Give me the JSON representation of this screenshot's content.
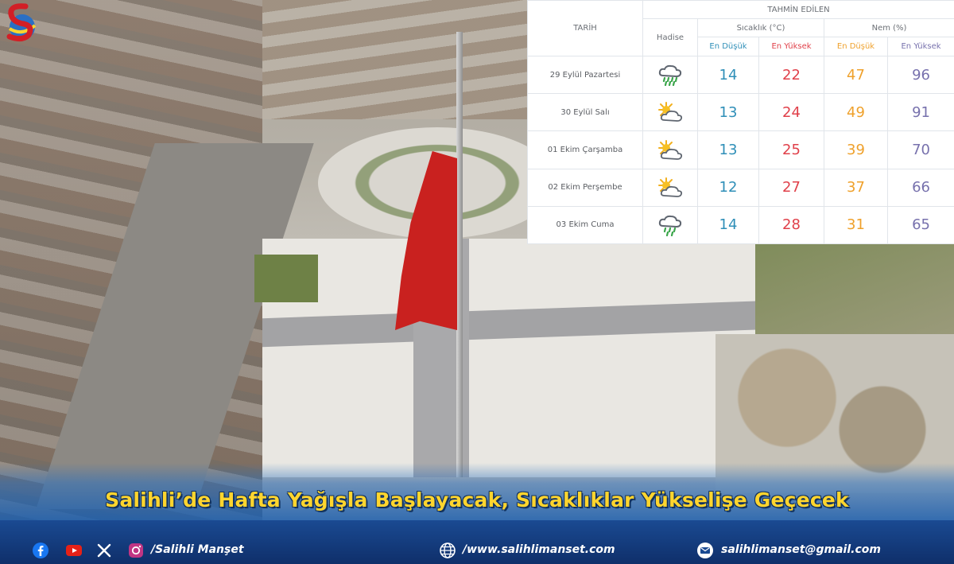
{
  "forecast": {
    "header_forecast": "TAHMİN EDİLEN",
    "col_date": "TARİH",
    "col_event": "Hadise",
    "col_temp": "Sıcaklık (°C)",
    "col_humidity": "Nem (%)",
    "sub_low": "En Düşük",
    "sub_high": "En Yüksek",
    "rows": [
      {
        "date": "29 Eylül Pazartesi",
        "icon": "rain-cloud-icon",
        "temp_low": "14",
        "temp_high": "22",
        "hum_low": "47",
        "hum_high": "96"
      },
      {
        "date": "30 Eylül Salı",
        "icon": "partly-cloudy-icon",
        "temp_low": "13",
        "temp_high": "24",
        "hum_low": "49",
        "hum_high": "91"
      },
      {
        "date": "01 Ekim Çarşamba",
        "icon": "partly-cloudy-icon",
        "temp_low": "13",
        "temp_high": "25",
        "hum_low": "39",
        "hum_high": "70"
      },
      {
        "date": "02 Ekim Perşembe",
        "icon": "partly-cloudy-icon",
        "temp_low": "12",
        "temp_high": "27",
        "hum_low": "37",
        "hum_high": "66"
      },
      {
        "date": "03 Ekim Cuma",
        "icon": "rain-cloud-icon",
        "temp_low": "14",
        "temp_high": "28",
        "hum_low": "31",
        "hum_high": "65"
      }
    ]
  },
  "headline": "Salihli’de Hafta Yağışla Başlayacak, Sıcaklıklar Yükselişe Geçecek",
  "footer": {
    "social_handle": "/Salihli Manşet",
    "website": "/www.salihlimanset.com",
    "email": "salihlimanset@gmail.com",
    "icons": [
      "facebook-icon",
      "youtube-icon",
      "x-icon",
      "instagram-icon",
      "globe-icon",
      "email-icon"
    ]
  },
  "colors": {
    "temp_low": "#2f8fb8",
    "temp_high": "#e0404a",
    "hum_low": "#efa12c",
    "hum_high": "#7771ad",
    "headline": "#ffd52e",
    "footer_bg": "#1a4a92"
  }
}
